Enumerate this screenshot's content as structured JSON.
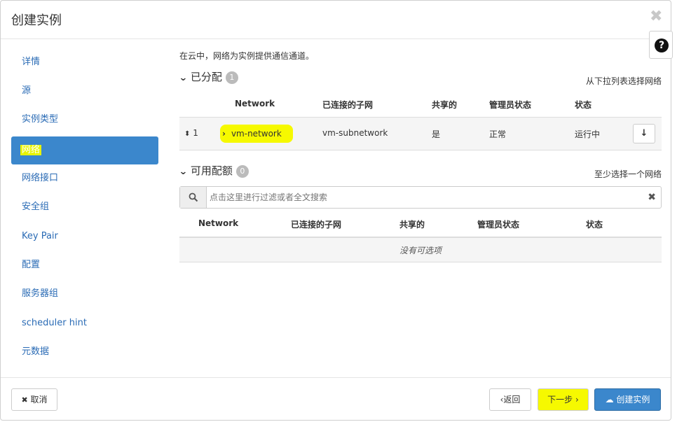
{
  "modal": {
    "title": "创建实例"
  },
  "sidebar": {
    "items": [
      {
        "label": "详情"
      },
      {
        "label": "源"
      },
      {
        "label": "实例类型"
      },
      {
        "label": "网络"
      },
      {
        "label": "网络接口"
      },
      {
        "label": "安全组"
      },
      {
        "label": "Key Pair"
      },
      {
        "label": "配置"
      },
      {
        "label": "服务器组"
      },
      {
        "label": "scheduler hint"
      },
      {
        "label": "元数据"
      }
    ],
    "active_index": 3
  },
  "main": {
    "description": "在云中，网络为实例提供通信通道。",
    "allocated": {
      "title": "已分配",
      "count": "1",
      "hint": "从下拉列表选择网络",
      "columns": [
        "Network",
        "已连接的子网",
        "共享的",
        "管理员状态",
        "状态"
      ],
      "rows": [
        {
          "order": "1",
          "network": "vm-network",
          "subnet": "vm-subnetwork",
          "shared": "是",
          "admin_state": "正常",
          "status": "运行中"
        }
      ]
    },
    "available": {
      "title": "可用配额",
      "count": "0",
      "hint": "至少选择一个网络",
      "search_placeholder": "点击这里进行过滤或者全文搜索",
      "columns": [
        "Network",
        "已连接的子网",
        "共享的",
        "管理员状态",
        "状态"
      ],
      "empty_text": "没有可选项"
    }
  },
  "footer": {
    "cancel_label": "取消",
    "back_label": "返回",
    "next_label": "下一步",
    "create_label": "创建实例"
  },
  "colors": {
    "primary": "#3b87cc",
    "highlight": "#f6f900",
    "link": "#2a6bb5"
  }
}
